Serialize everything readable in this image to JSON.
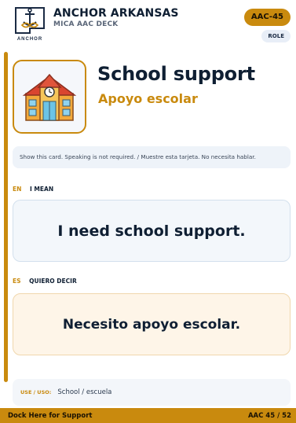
{
  "header": {
    "brand_name": "ANCHOR ARKANSAS",
    "brand_sub": "MICA AAC DECK",
    "logo_text": "ANCHOR",
    "card_code": "AAC-45",
    "role_badge": "ROLE"
  },
  "card": {
    "icon": "school-icon",
    "title_en": "School support",
    "title_es": "Apoyo escolar",
    "note": "Show this card. Speaking is not required. / Muestre esta tarjeta. No necesita hablar."
  },
  "english": {
    "code": "EN",
    "label": "I MEAN",
    "phrase": "I need school support."
  },
  "spanish": {
    "code": "ES",
    "label": "QUIERO DECIR",
    "phrase": "Necesito apoyo escolar."
  },
  "use": {
    "label": "USE / USO:",
    "value": "School / escuela"
  },
  "footer": {
    "left": "Dock Here for Support",
    "right": "AAC 45 / 52"
  },
  "colors": {
    "accent": "#c98a0e",
    "ink": "#0f1f33",
    "english_panel": "#f3f7fb",
    "spanish_panel": "#fef5e8"
  }
}
